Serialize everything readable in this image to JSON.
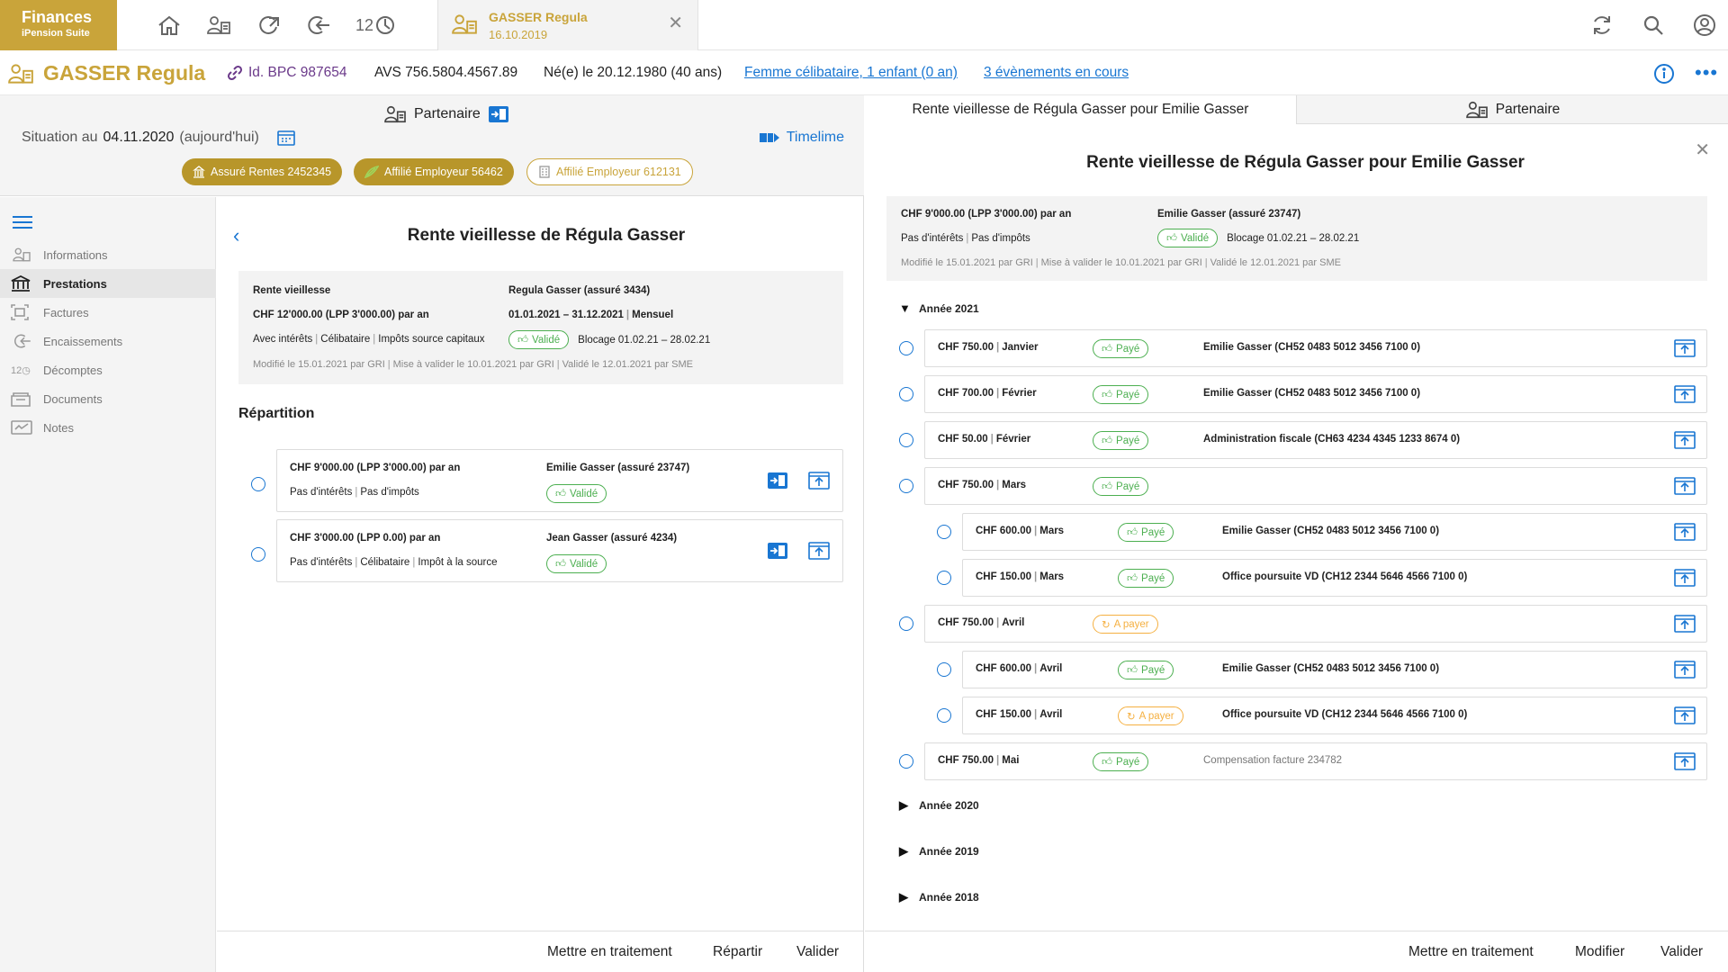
{
  "app": {
    "name": "Finances",
    "suite": "iPension Suite"
  },
  "colors": {
    "brand": "#c9a43a",
    "link": "#1976d2",
    "paid": "#4caf50",
    "to_pay": "#f5b041"
  },
  "top_icons": [
    "home-icon",
    "persons-icon",
    "forward-icon",
    "return-icon",
    "counter-icon"
  ],
  "top_icons_counter_text": "12",
  "doc_tab": {
    "title": "GASSER Regula",
    "date": "16.10.2019"
  },
  "person": {
    "name": "GASSER Regula",
    "id": "Id. BPC 987654",
    "avs": "AVS 756.5804.4567.89",
    "birth": "Né(e) le 20.12.1980 (40 ans)",
    "family_link": "Femme célibataire, 1 enfant (0 an)",
    "events_link": "3 évènements en cours"
  },
  "left": {
    "partner_label": "Partenaire",
    "situation_prefix": "Situation au",
    "situation_date": "04.11.2020",
    "situation_suffix": "(aujourd'hui)",
    "timeline_label": "Timelime",
    "pills": [
      "Assuré Rentes 2452345",
      "Affilié Employeur 56462",
      "Affilié Employeur 612131"
    ],
    "nav": [
      {
        "label": "Informations",
        "icon": "person-icon"
      },
      {
        "label": "Prestations",
        "icon": "bank-icon",
        "active": true
      },
      {
        "label": "Factures",
        "icon": "invoice-icon"
      },
      {
        "label": "Encaissements",
        "icon": "collection-icon"
      },
      {
        "label": "Décomptes",
        "icon": "counter-icon"
      },
      {
        "label": "Documents",
        "icon": "documents-icon"
      },
      {
        "label": "Notes",
        "icon": "notes-icon"
      }
    ],
    "title": "Rente vieillesse de Régula Gasser",
    "summary": {
      "type": "Rente vieillesse",
      "amount": "CHF 12'000.00 (LPP 3'000.00) par an",
      "details": [
        "Avec intérêts",
        "Célibataire",
        "Impôts source capitaux"
      ],
      "person": "Regula Gasser (assuré 3434)",
      "period": "01.01.2021 – 31.12.2021",
      "frequency": "Mensuel",
      "status": "Validé",
      "blocage": "Blocage 01.02.21 – 28.02.21",
      "audit": [
        "Modifié le 15.01.2021 par GRI",
        "Mise à valider le 10.01.2021 par GRI",
        "Validé le 12.01.2021 par SME"
      ]
    },
    "repartition_title": "Répartition",
    "repartition": [
      {
        "amount": "CHF 9'000.00 (LPP 3'000.00) par an",
        "details": [
          "Pas d'intérêts",
          "Pas d'impôts"
        ],
        "beneficiary": "Emilie Gasser (assuré 23747)",
        "status": "Validé"
      },
      {
        "amount": "CHF 3'000.00  (LPP 0.00) par an",
        "details": [
          "Pas d'intérêts",
          "Célibataire",
          "Impôt à la source"
        ],
        "beneficiary": "Jean Gasser (assuré 4234)",
        "status": "Validé"
      }
    ],
    "actions": [
      "Mettre en traitement",
      "Répartir",
      "Valider"
    ]
  },
  "right": {
    "tab_active": "Rente vieillesse de Régula Gasser pour Emilie Gasser",
    "tab_partner": "Partenaire",
    "title": "Rente vieillesse de Régula Gasser pour Emilie Gasser",
    "summary": {
      "amount": "CHF 9'000.00 (LPP 3'000.00) par an",
      "details": [
        "Pas d'intérêts",
        "Pas d'impôts"
      ],
      "person": "Emilie Gasser (assuré 23747)",
      "status": "Validé",
      "blocage": "Blocage 01.02.21 – 28.02.21",
      "audit": [
        "Modifié le 15.01.2021 par GRI",
        "Mise à valider le 10.01.2021 par GRI",
        "Validé le 12.01.2021 par SME"
      ]
    },
    "year_open": "Année 2021",
    "payments": [
      {
        "amount": "CHF 750.00",
        "month": "Janvier",
        "status": "Payé",
        "beneficiary": "Emilie Gasser (CH52 0483 5012 3456 7100 0)"
      },
      {
        "amount": "CHF 700.00",
        "month": "Février",
        "status": "Payé",
        "beneficiary": "Emilie Gasser (CH52 0483 5012 3456 7100 0)"
      },
      {
        "amount": "CHF 50.00",
        "month": "Février",
        "status": "Payé",
        "beneficiary": "Administration fiscale (CH63 4234 4345 1233 8674 0)"
      },
      {
        "amount": "CHF 750.00",
        "month": "Mars",
        "status": "Payé",
        "beneficiary": ""
      },
      {
        "amount": "CHF 600.00",
        "month": "Mars",
        "status": "Payé",
        "beneficiary": "Emilie Gasser (CH52 0483 5012 3456 7100 0)"
      },
      {
        "amount": "CHF 150.00",
        "month": "Mars",
        "status": "Payé",
        "beneficiary": "Office poursuite VD (CH12 2344 5646 4566 7100 0)"
      },
      {
        "amount": "CHF 750.00",
        "month": "Avril",
        "status": "A payer",
        "beneficiary": ""
      },
      {
        "amount": "CHF 600.00",
        "month": "Avril",
        "status": "Payé",
        "beneficiary": "Emilie Gasser (CH52 0483 5012 3456 7100 0)"
      },
      {
        "amount": "CHF 150.00",
        "month": "Avril",
        "status": "A payer",
        "beneficiary": "Office poursuite VD (CH12 2344 5646 4566 7100 0)"
      },
      {
        "amount": "CHF 750.00",
        "month": "Mai",
        "status": "Payé",
        "beneficiary": "Compensation facture 234782"
      }
    ],
    "years_closed": [
      "Année 2020",
      "Année 2019",
      "Année 2018"
    ],
    "actions": [
      "Mettre en traitement",
      "Modifier",
      "Valider"
    ]
  }
}
